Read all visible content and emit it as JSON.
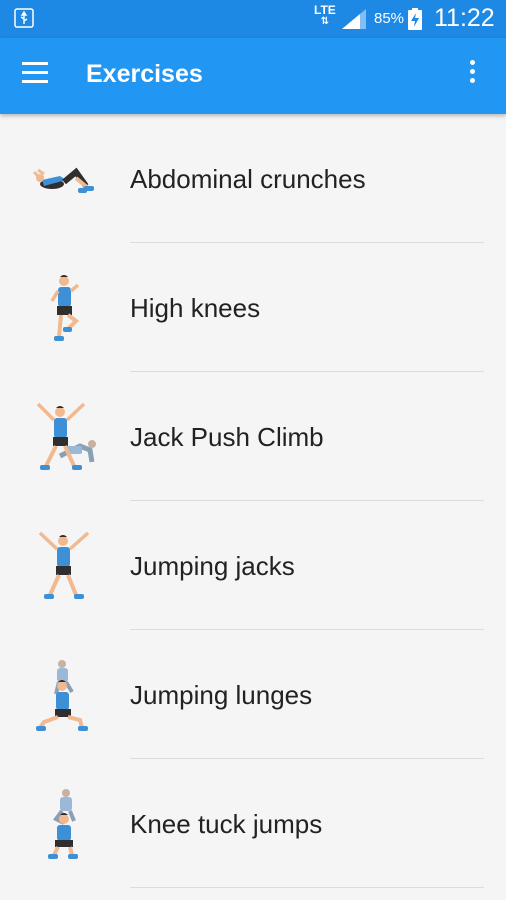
{
  "status_bar": {
    "network": "LTE",
    "battery_percent": "85%",
    "time": "11:22"
  },
  "app_bar": {
    "title": "Exercises",
    "menu_icon": "hamburger-menu-icon",
    "overflow_icon": "more-vert-icon"
  },
  "exercises": [
    {
      "label": "Abdominal crunches",
      "icon": "crunches-figure-icon"
    },
    {
      "label": "High knees",
      "icon": "high-knees-figure-icon"
    },
    {
      "label": "Jack Push Climb",
      "icon": "jack-push-climb-figure-icon"
    },
    {
      "label": "Jumping jacks",
      "icon": "jumping-jacks-figure-icon"
    },
    {
      "label": "Jumping lunges",
      "icon": "jumping-lunges-figure-icon"
    },
    {
      "label": "Knee tuck jumps",
      "icon": "knee-tuck-jumps-figure-icon"
    }
  ],
  "colors": {
    "status_bar": "#1e88e5",
    "app_bar": "#2196f3",
    "background": "#f5f5f5",
    "figure_shirt": "#3d8fd6",
    "figure_skin": "#f1b98f"
  }
}
